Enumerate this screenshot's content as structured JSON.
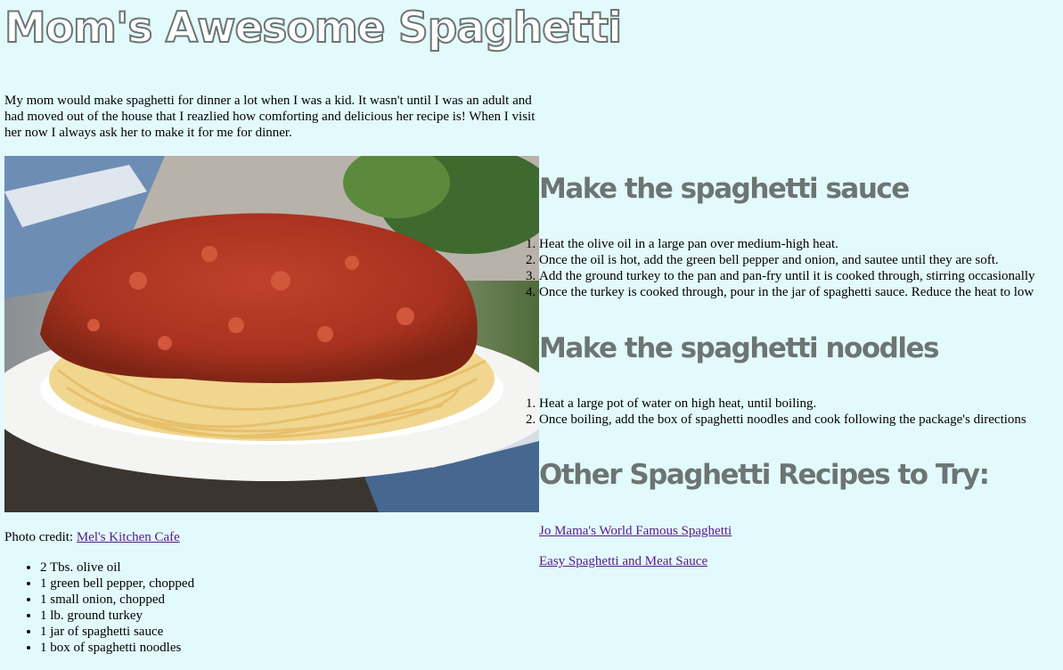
{
  "page": {
    "title": "Mom's Awesome Spaghetti",
    "intro": "My mom would make spaghetti for dinner a lot when I was a kid. It wasn't until I was an adult and had moved out of the house that I reazlied how comforting and delicious her recipe is! When I visit her now I always ask her to make it for me for dinner.",
    "photo_credit_label": "Photo credit:",
    "photo_credit_link": "Mel's Kitchen Cafe"
  },
  "ingredients": [
    "2 Tbs. olive oil",
    "1 green bell pepper, chopped",
    "1 small onion, chopped",
    "1 lb. ground turkey",
    "1 jar of spaghetti sauce",
    "1 box of spaghetti noodles"
  ],
  "sauce": {
    "heading": "Make the spaghetti sauce",
    "steps": [
      "Heat the olive oil in a large pan over medium-high heat.",
      "Once the oil is hot, add the green bell pepper and onion, and sautee until they are soft.",
      "Add the ground turkey to the pan and pan-fry until it is cooked through, stirring occasionally",
      "Once the turkey is cooked through, pour in the jar of spaghetti sauce. Reduce the heat to low"
    ]
  },
  "noodles": {
    "heading": "Make the spaghetti noodles",
    "steps": [
      "Heat a large pot of water on high heat, until boiling.",
      "Once boiling, add the box of spaghetti noodles and cook following the package's directions"
    ]
  },
  "other": {
    "heading": "Other Spaghetti Recipes to Try:",
    "links": [
      "Jo Mama's World Famous Spaghetti",
      "Easy Spaghetti and Meat Sauce"
    ]
  },
  "colors": {
    "background": "#e3fafd",
    "heading": "#6c7573",
    "link": "#551a8b"
  }
}
